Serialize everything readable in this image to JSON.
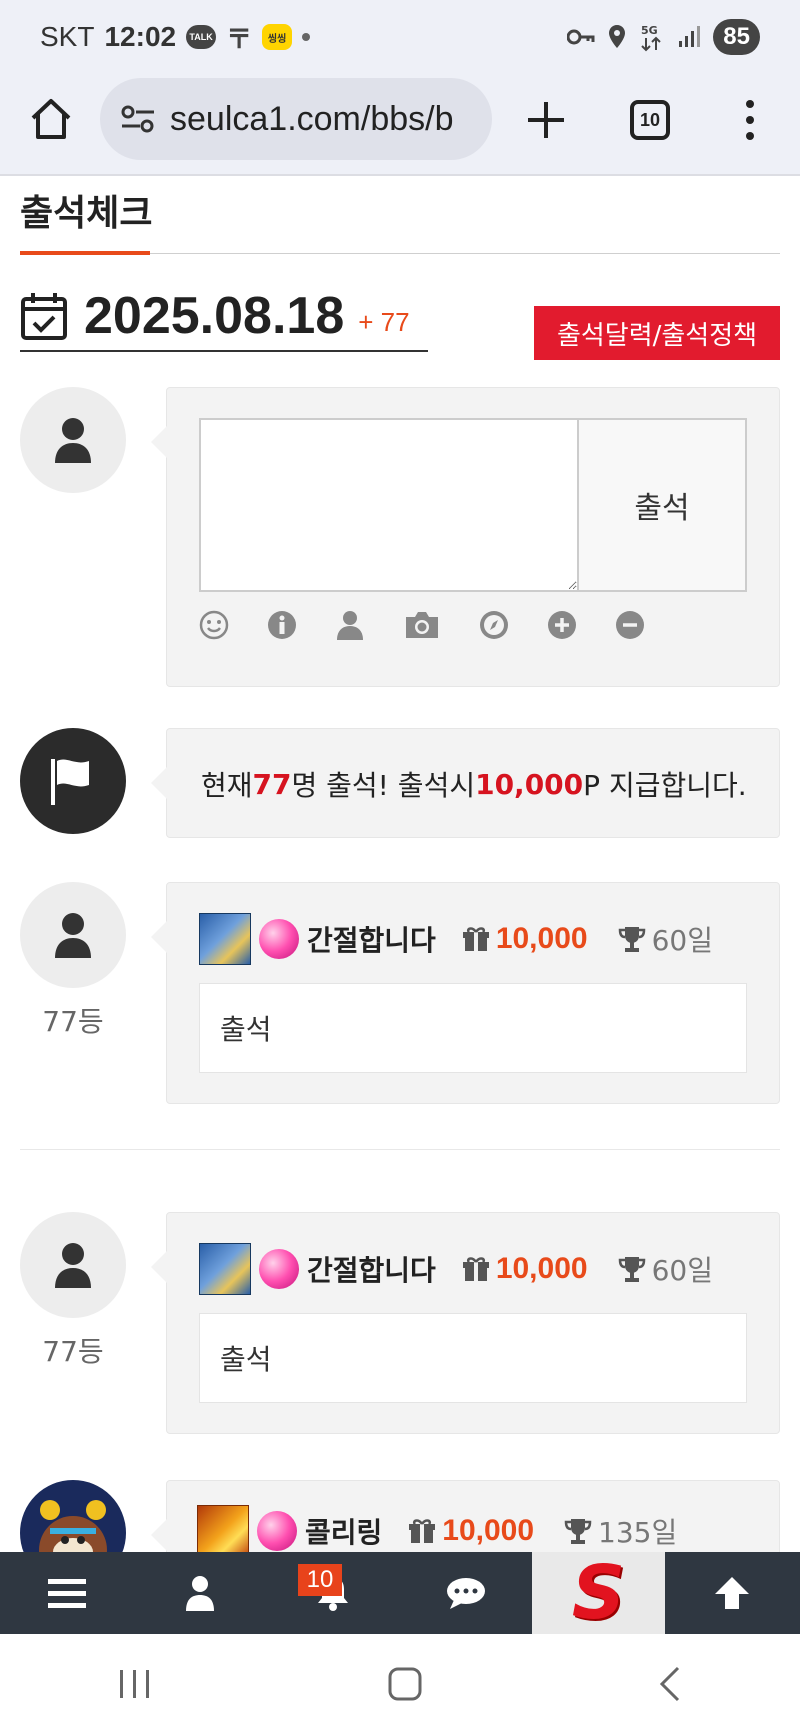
{
  "status_bar": {
    "carrier": "SKT",
    "time": "12:02",
    "battery": "85",
    "icons": [
      "kakaotalk-icon",
      "t-icon",
      "kakao-notification-icon",
      "dot-icon",
      "key-icon",
      "location-icon",
      "5g-icon",
      "signal-icon",
      "battery-icon"
    ]
  },
  "browser": {
    "url": "seulca1.com/bbs/b",
    "tab_count": "10"
  },
  "page": {
    "title": "출석체크",
    "date": "2025.08.18",
    "date_count": "+ 77",
    "policy_button": "출석달력/출석정책",
    "accent_color": "#e84a1a",
    "red_color": "#e21b2e"
  },
  "compose": {
    "input_value": "",
    "submit_label": "출석",
    "tools": [
      "emoji-icon",
      "info-icon",
      "user-icon",
      "camera-icon",
      "compass-icon",
      "plus-circle-icon",
      "minus-circle-icon"
    ]
  },
  "notice": {
    "prefix": "현재 ",
    "count": "77",
    "middle": "명 출석! 출석시 ",
    "points": "10,000",
    "suffix": "P 지급합니다."
  },
  "entries": [
    {
      "rank": "77등",
      "nickname": "간절합니다",
      "points": "10,000",
      "days": "60일",
      "comment": "출석"
    },
    {
      "rank": "77등",
      "nickname": "간절합니다",
      "points": "10,000",
      "days": "60일",
      "comment": "출석"
    },
    {
      "rank": "",
      "nickname": "콜리링",
      "points": "10,000",
      "days": "135일",
      "comment": ""
    }
  ],
  "bottom_nav": {
    "notification_badge": "10",
    "items": [
      "menu-icon",
      "user-icon",
      "bell-icon",
      "chat-icon",
      "site-logo",
      "arrow-up-icon"
    ],
    "logo_letter": "S"
  }
}
